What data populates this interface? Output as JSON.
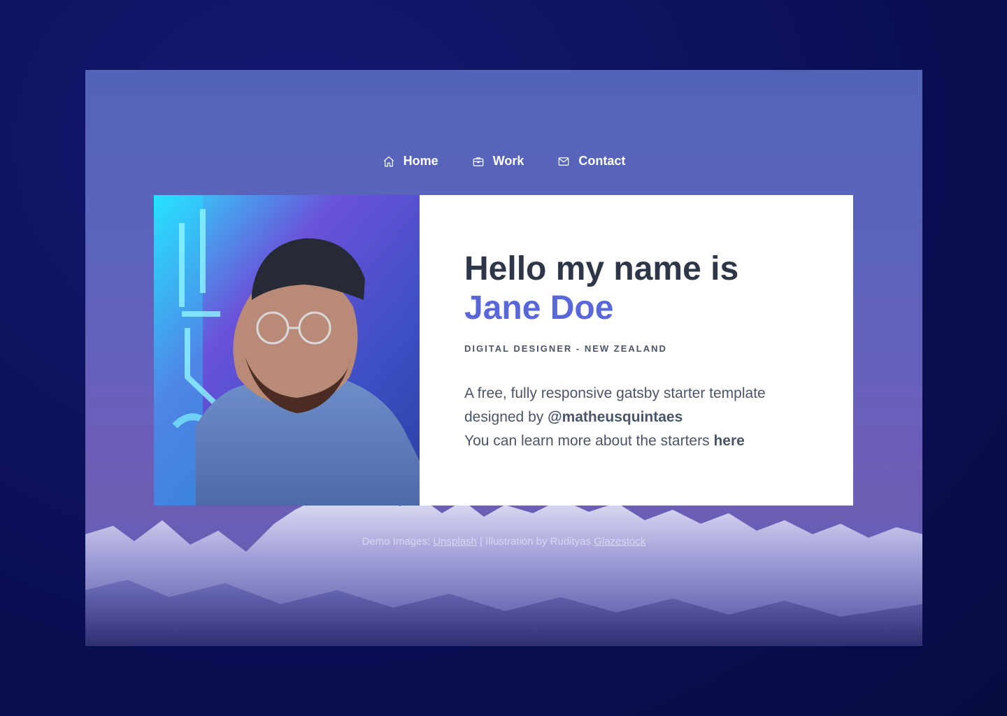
{
  "nav": {
    "items": [
      {
        "label": "Home",
        "icon": "home-icon"
      },
      {
        "label": "Work",
        "icon": "briefcase-icon"
      },
      {
        "label": "Contact",
        "icon": "mail-icon"
      }
    ]
  },
  "hero": {
    "greeting": "Hello my name is",
    "name": "Jane Doe",
    "subtitle": "DIGITAL DESIGNER - NEW ZEALAND",
    "desc_line1": "A free, fully responsive gatsby starter template",
    "desc_line2_prefix": "designed by ",
    "desc_handle": "@matheusquintaes",
    "desc_line3_prefix": "You can learn more about the starters ",
    "desc_link": "here"
  },
  "credits": {
    "prefix": "Demo Images: ",
    "link1": "Unsplash",
    "middle": " | Illustration by Rudityas ",
    "link2": "Glazestock"
  },
  "colors": {
    "accent": "#5a67d8",
    "heading": "#2d3748",
    "text": "#4a5568",
    "outer_background": "#0b1058"
  }
}
